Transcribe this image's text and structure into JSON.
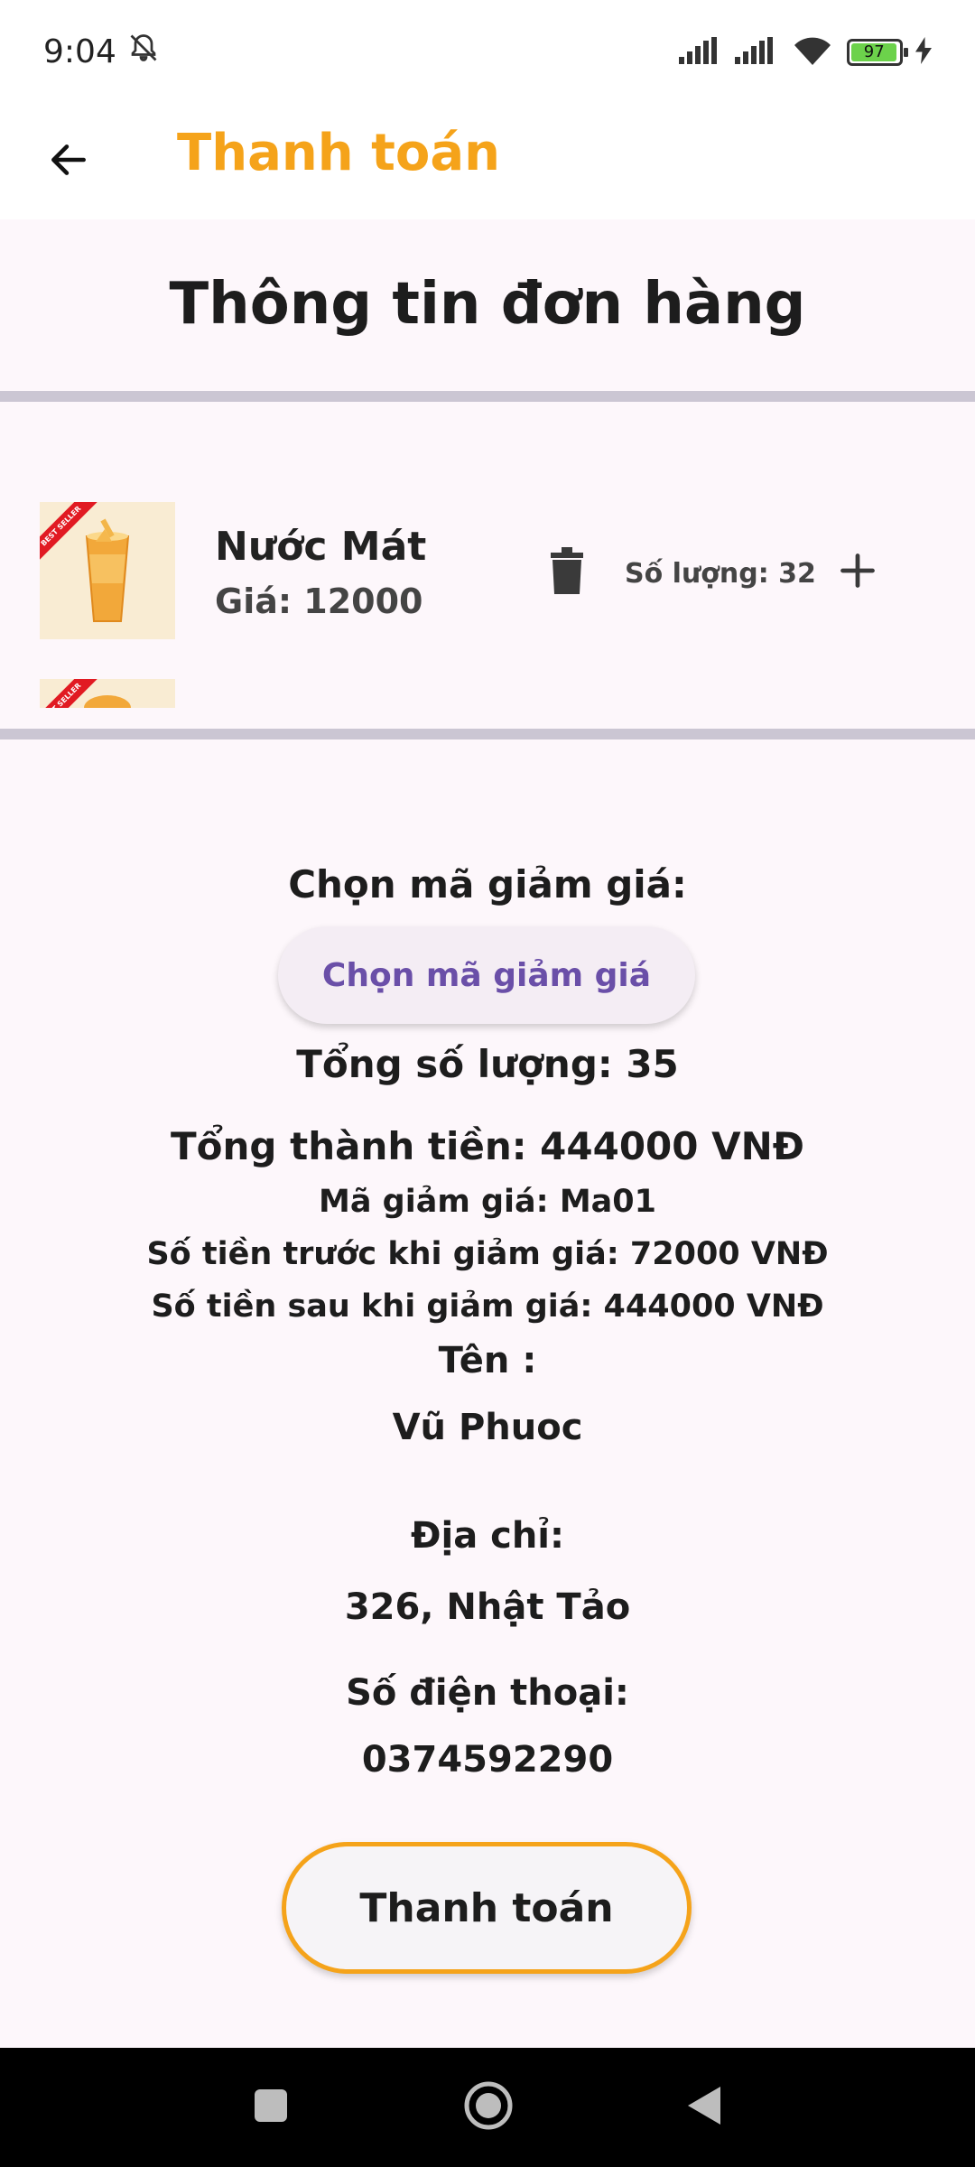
{
  "status_bar": {
    "time": "9:04",
    "battery": "97"
  },
  "app_bar": {
    "title": "Thanh toán"
  },
  "section_title": "Thông tin đơn hàng",
  "cart_items": [
    {
      "name": "Nước Mát",
      "price": "Giá: 12000",
      "quantity": "Số lượng: 32",
      "badge": "BEST SELLER"
    },
    {
      "badge": "BEST SELLER"
    }
  ],
  "discount": {
    "label": "Chọn mã giảm giá:",
    "button": "Chọn mã giảm giá"
  },
  "summary": {
    "total_quantity": "Tổng số lượng: 35",
    "total_amount": "Tổng thành tiền: 444000 VNĐ",
    "discount_code": "Mã giảm giá: Ma01",
    "before_discount": "Số tiền trước khi giảm giá: 72000 VNĐ",
    "after_discount": "Số tiền sau khi giảm giá: 444000 VNĐ"
  },
  "customer": {
    "name_label": "Tên :",
    "name": "Vũ Phuoc",
    "address_label": "Địa chỉ:",
    "address": "326, Nhật Tảo",
    "phone_label": "Số điện thoại:",
    "phone": "0374592290"
  },
  "pay_button": "Thanh toán",
  "icons": {
    "back": "arrow-left-icon",
    "trash": "trash-icon",
    "plus": "plus-icon",
    "signal": "signal-icon",
    "wifi": "wifi-icon",
    "mute": "bell-off-icon",
    "charging": "bolt-icon"
  },
  "colors": {
    "accent": "#f5a31a",
    "voucher_text": "#6a4fa8",
    "background": "#fdf7fb",
    "divider": "#cbc6d3"
  }
}
